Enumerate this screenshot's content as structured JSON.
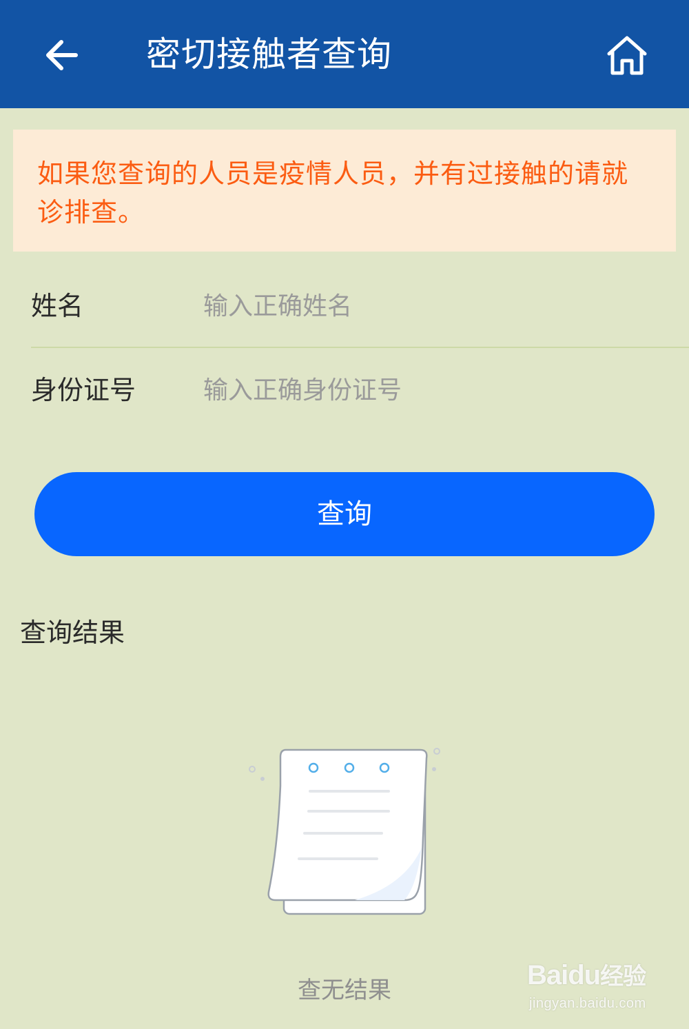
{
  "header": {
    "title": "密切接触者查询",
    "back_icon": "arrow-left-icon",
    "home_icon": "home-icon",
    "background_color": "#1254a5"
  },
  "notice": {
    "text": "如果您查询的人员是疫情人员，并有过接触的请就诊排查。",
    "text_color": "#fb5c12",
    "background_color": "#fdebd6"
  },
  "form": {
    "name_label": "姓名",
    "name_placeholder": "输入正确姓名",
    "name_value": "",
    "id_label": "身份证号",
    "id_placeholder": "输入正确身份证号",
    "id_value": ""
  },
  "query_button": {
    "label": "查询",
    "color": "#0866ff"
  },
  "results": {
    "title": "查询结果",
    "empty_text": "查无结果",
    "empty_icon": "empty-notepad-icon"
  },
  "watermark": {
    "logo": "Bai",
    "logo_mid": "du",
    "logo_cn": "经验",
    "url": "jingyan.baidu.com"
  }
}
